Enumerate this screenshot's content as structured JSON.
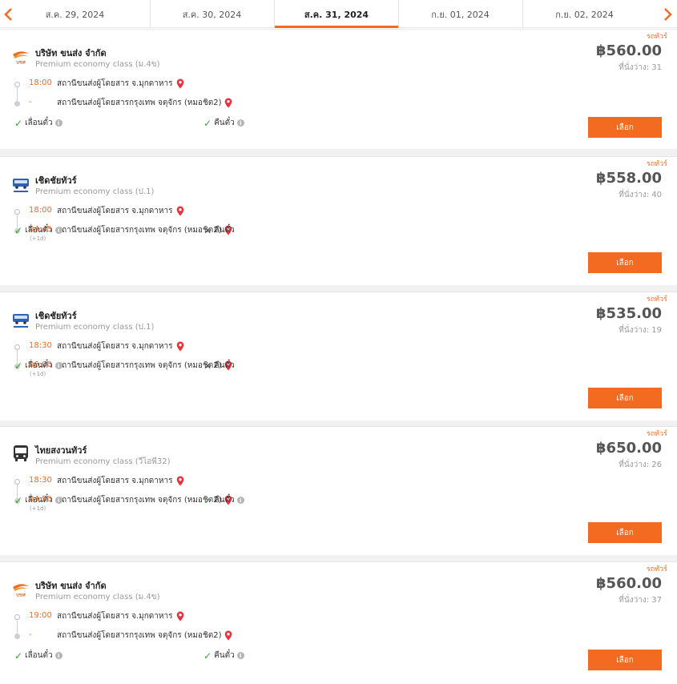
{
  "colors": {
    "accent": "#f26b21",
    "check": "#3aa43a",
    "pin": "#e8333d"
  },
  "date_tabs": [
    {
      "label": "ส.ค. 29, 2024",
      "active": false
    },
    {
      "label": "ส.ค. 30, 2024",
      "active": false
    },
    {
      "label": "ส.ค. 31, 2024",
      "active": true
    },
    {
      "label": "ก.ย. 01, 2024",
      "active": false
    },
    {
      "label": "ก.ย. 02, 2024",
      "active": false
    }
  ],
  "trips": [
    {
      "tag": "รถทัวร์",
      "logo": "bks-logo",
      "operator": "บริษัท ขนส่ง จำกัด",
      "class": "Premium economy class (ม.4ข)",
      "price": "฿560.00",
      "seats": "ที่นั่งว่าง: 31",
      "depart_time": "18:00",
      "depart_place": "สถานีขนส่งผู้โดยสาร จ.มุกดาหาร",
      "arrive_time": "-",
      "arrive_place": "สถานีขนส่งผู้โดยสารกรุงเทพ จตุจักร (หมอชิต2)",
      "arrive_next_day": "",
      "change_label": "เลื่อนตั๋ว",
      "change_ok": true,
      "refund_label": "คืนตั๋ว",
      "refund_ok": true,
      "button": "เลือก"
    },
    {
      "tag": "รถทัวร์",
      "logo": "cherdchai-bus-logo",
      "operator": "เชิดชัยทัวร์",
      "class": "Premium economy class (ป.1)",
      "price": "฿558.00",
      "seats": "ที่นั่งว่าง: 40",
      "depart_time": "18:00",
      "depart_place": "สถานีขนส่งผู้โดยสาร จ.มุกดาหาร",
      "arrive_time": "04:45",
      "arrive_place": "สถานีขนส่งผู้โดยสารกรุงเทพ จตุจักร (หมอชิต2)",
      "arrive_next_day": "(+1d)",
      "change_label": "เลื่อนตั๋ว",
      "change_ok": true,
      "refund_label": "คืนตั๋ว",
      "refund_ok": false,
      "button": "เลือก"
    },
    {
      "tag": "รถทัวร์",
      "logo": "cherdchai-bus-logo",
      "operator": "เชิดชัยทัวร์",
      "class": "Premium economy class (ป.1)",
      "price": "฿535.00",
      "seats": "ที่นั่งว่าง: 19",
      "depart_time": "18:30",
      "depart_place": "สถานีขนส่งผู้โดยสาร จ.มุกดาหาร",
      "arrive_time": "06:00",
      "arrive_place": "สถานีขนส่งผู้โดยสารกรุงเทพ จตุจักร (หมอชิต2)",
      "arrive_next_day": "(+1d)",
      "change_label": "เลื่อนตั๋ว",
      "change_ok": true,
      "refund_label": "คืนตั๋ว",
      "refund_ok": false,
      "button": "เลือก"
    },
    {
      "tag": "รถทัวร์",
      "logo": "bus-icon",
      "operator": "ไทยสงวนทัวร์",
      "class": "Premium economy class (วีไอพี32)",
      "price": "฿650.00",
      "seats": "ที่นั่งว่าง: 26",
      "depart_time": "18:30",
      "depart_place": "สถานีขนส่งผู้โดยสาร จ.มุกดาหาร",
      "arrive_time": "04:50",
      "arrive_place": "สถานีขนส่งผู้โดยสารกรุงเทพ จตุจักร (หมอชิต2)",
      "arrive_next_day": "(+1d)",
      "change_label": "เลื่อนตั๋ว",
      "change_ok": true,
      "refund_label": "คืนตั๋ว",
      "refund_ok": true,
      "button": "เลือก"
    },
    {
      "tag": "รถทัวร์",
      "logo": "bks-logo",
      "operator": "บริษัท ขนส่ง จำกัด",
      "class": "Premium economy class (ม.4ข)",
      "price": "฿560.00",
      "seats": "ที่นั่งว่าง: 37",
      "depart_time": "19:00",
      "depart_place": "สถานีขนส่งผู้โดยสาร จ.มุกดาหาร",
      "arrive_time": "-",
      "arrive_place": "สถานีขนส่งผู้โดยสารกรุงเทพ จตุจักร (หมอชิต2)",
      "arrive_next_day": "",
      "change_label": "เลื่อนตั๋ว",
      "change_ok": true,
      "refund_label": "คืนตั๋ว",
      "refund_ok": true,
      "button": "เลือก"
    }
  ]
}
